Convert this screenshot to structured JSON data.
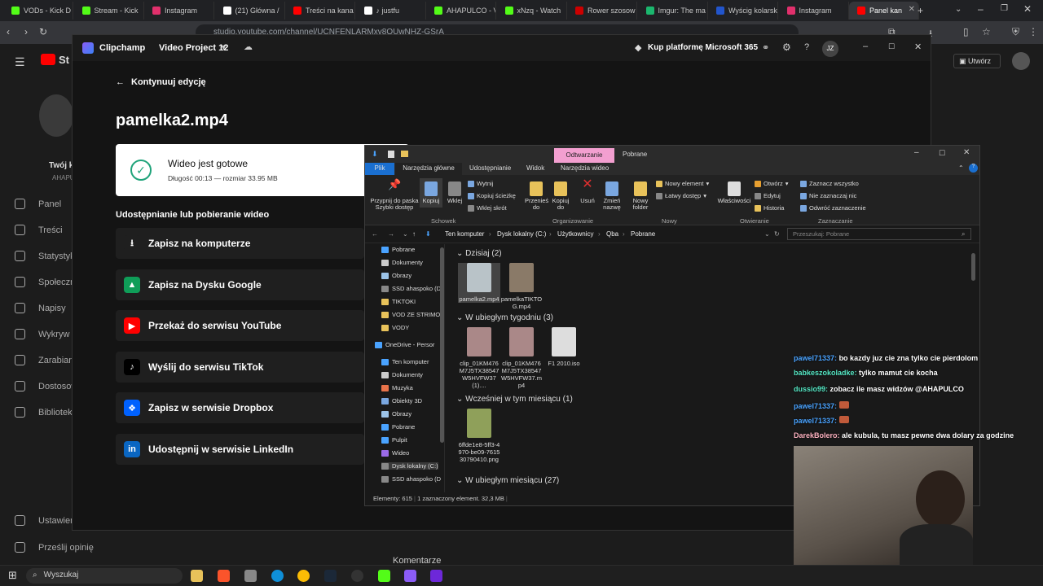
{
  "browser": {
    "tabs": [
      {
        "label": "VODs - Kick D",
        "color": "#53fc18"
      },
      {
        "label": "Stream - Kick",
        "color": "#53fc18"
      },
      {
        "label": "Instagram",
        "color": "#e1306c"
      },
      {
        "label": "(21) Główna /",
        "color": "#ffffff"
      },
      {
        "label": "Treści na kana",
        "color": "#ff0000"
      },
      {
        "label": "♪ justfu",
        "color": "#ffffff"
      },
      {
        "label": "AHAPULCO - V",
        "color": "#53fc18"
      },
      {
        "label": "xNzq - Watch",
        "color": "#53fc18"
      },
      {
        "label": "Rower szosow",
        "color": "#cc0000"
      },
      {
        "label": "Imgur: The ma",
        "color": "#1bb76e"
      },
      {
        "label": "Wyścig kolarsk",
        "color": "#2255cc"
      },
      {
        "label": "Instagram",
        "color": "#e1306c"
      },
      {
        "label": "Panel kan",
        "color": "#ff0000"
      }
    ],
    "url": "studio.youtube.com/channel/UCNFENLARMxv8OUwNHZ-GSrA",
    "new_tab": "+"
  },
  "studio": {
    "logo": "St",
    "channel_label": "Twój k",
    "channel_sub": "AHAPU",
    "create_button": "Utwórz",
    "sidebar": [
      "Panel",
      "Treści",
      "Statystyk",
      "Społeczn",
      "Napisy",
      "Wykryw",
      "Zarabiani",
      "Dostosow",
      "Bibliotek"
    ],
    "settings": "Ustawien",
    "feedback": "Prześlij opinię",
    "comments": "Komentarze"
  },
  "clipchamp": {
    "app_name": "Clipchamp",
    "project": "Video Project 12",
    "promo": "Kup platformę Microsoft 365",
    "avatar": "JZ",
    "back": "Kontynuuj edycję",
    "file_title": "pamelka2.mp4",
    "ready_title": "Wideo jest gotowe",
    "ready_meta": "Długość 00:13 — rozmiar 33.95 MB",
    "share_heading": "Udostępnianie lub pobieranie wideo",
    "actions": [
      {
        "label": "Zapisz na komputerze",
        "icon": "download-icon",
        "color": "#1f1f1f",
        "glyph": "⭳"
      },
      {
        "label": "Zapisz na Dysku Google",
        "icon": "google-drive-icon",
        "color": "#0f9d58",
        "glyph": "▲"
      },
      {
        "label": "Przekaż do serwisu YouTube",
        "icon": "youtube-icon",
        "color": "#ff0000",
        "glyph": "▶"
      },
      {
        "label": "Wyślij do serwisu TikTok",
        "icon": "tiktok-icon",
        "color": "#000000",
        "glyph": "♪"
      },
      {
        "label": "Zapisz w serwisie Dropbox",
        "icon": "dropbox-icon",
        "color": "#0061fe",
        "glyph": "❖"
      },
      {
        "label": "Udostępnij w serwisie LinkedIn",
        "icon": "linkedin-icon",
        "color": "#0a66c2",
        "glyph": "in"
      }
    ]
  },
  "explorer": {
    "context_tab": "Odtwarzanie",
    "title": "Pobrane",
    "tabs": [
      "Plik",
      "Narzędzia główne",
      "Udostępnianie",
      "Widok",
      "Narzędzia wideo"
    ],
    "ribbon": {
      "pin": "Przypnij do paska Szybki dostęp",
      "copy": "Kopiuj",
      "paste": "Wklej",
      "cut": "Wytnij",
      "copy_path": "Kopiuj ścieżkę",
      "paste_shortcut": "Wklej skrót",
      "move_to": "Przenieś do",
      "copy_to": "Kopiuj do",
      "delete": "Usuń",
      "rename": "Zmień nazwę",
      "new_folder": "Nowy folder",
      "new_item": "Nowy element",
      "easy_access": "Łatwy dostęp",
      "properties": "Właściwości",
      "open": "Otwórz",
      "edit": "Edytuj",
      "history": "Historia",
      "select_all": "Zaznacz wszystko",
      "select_none": "Nie zaznaczaj nic",
      "invert": "Odwróć zaznaczenie",
      "groups": [
        "Schowek",
        "Organizowanie",
        "Nowy",
        "Otwieranie",
        "Zaznaczanie"
      ]
    },
    "breadcrumb": [
      "Ten komputer",
      "Dysk lokalny (C:)",
      "Użytkownicy",
      "Qba",
      "Pobrane"
    ],
    "search_placeholder": "Przeszukaj: Pobrane",
    "nav": [
      "Pobrane",
      "Dokumenty",
      "Obrazy",
      "SSD ahaspoko (D",
      "TIKTOKI",
      "VOD ZE STRIMO",
      "VODY",
      "OneDrive - Persor",
      "Ten komputer",
      "Dokumenty",
      "Muzyka",
      "Obiekty 3D",
      "Obrazy",
      "Pobrane",
      "Pulpit",
      "Wideo",
      "Dysk lokalny (C:)",
      "SSD ahaspoko (D"
    ],
    "groups": [
      {
        "header": "Dzisiaj (2)",
        "files": [
          "pamelka2.mp4",
          "pamelkaTIKTOG.mp4"
        ]
      },
      {
        "header": "W ubiegłym tygodniu (3)",
        "files": [
          "clip_01KM476M7J5TX38547W5HVFW37 (1)....",
          "clip_01KM476M7J5TX38547W5HVFW37.mp4",
          "F1 2010.iso"
        ]
      },
      {
        "header": "Wcześniej w tym miesiącu (1)",
        "files": [
          "6ffde1e8-5ff3-4970-be09-761530790410.png"
        ]
      },
      {
        "header": "W ubiegłym miesiącu (27)",
        "files": []
      }
    ],
    "status_count": "Elementy: 615",
    "status_selected": "1 zaznaczony element. 32,3 MB"
  },
  "chat": [
    {
      "user": "pawel71337:",
      "msg": "bo kazdy juz cie zna tylko cie pierdolom",
      "color": "#4aa3ff"
    },
    {
      "user": "babkeszokoladke:",
      "msg": "tylko mamut cie kocha",
      "color": "#56e8c5"
    },
    {
      "user": "dussio99:",
      "msg": "zobacz ile masz widzów @AHAPULCO",
      "color": "#56e8c5"
    },
    {
      "user": "pawel71337:",
      "msg": "",
      "color": "#4aa3ff"
    },
    {
      "user": "pawel71337:",
      "msg": "",
      "color": "#4aa3ff"
    },
    {
      "user": "DarekBolero:",
      "msg": "ale kubula, tu masz pewne dwa dolary za godzine",
      "color": "#ffb3c1"
    }
  ],
  "taskbar": {
    "search_placeholder": "Wyszukaj"
  }
}
